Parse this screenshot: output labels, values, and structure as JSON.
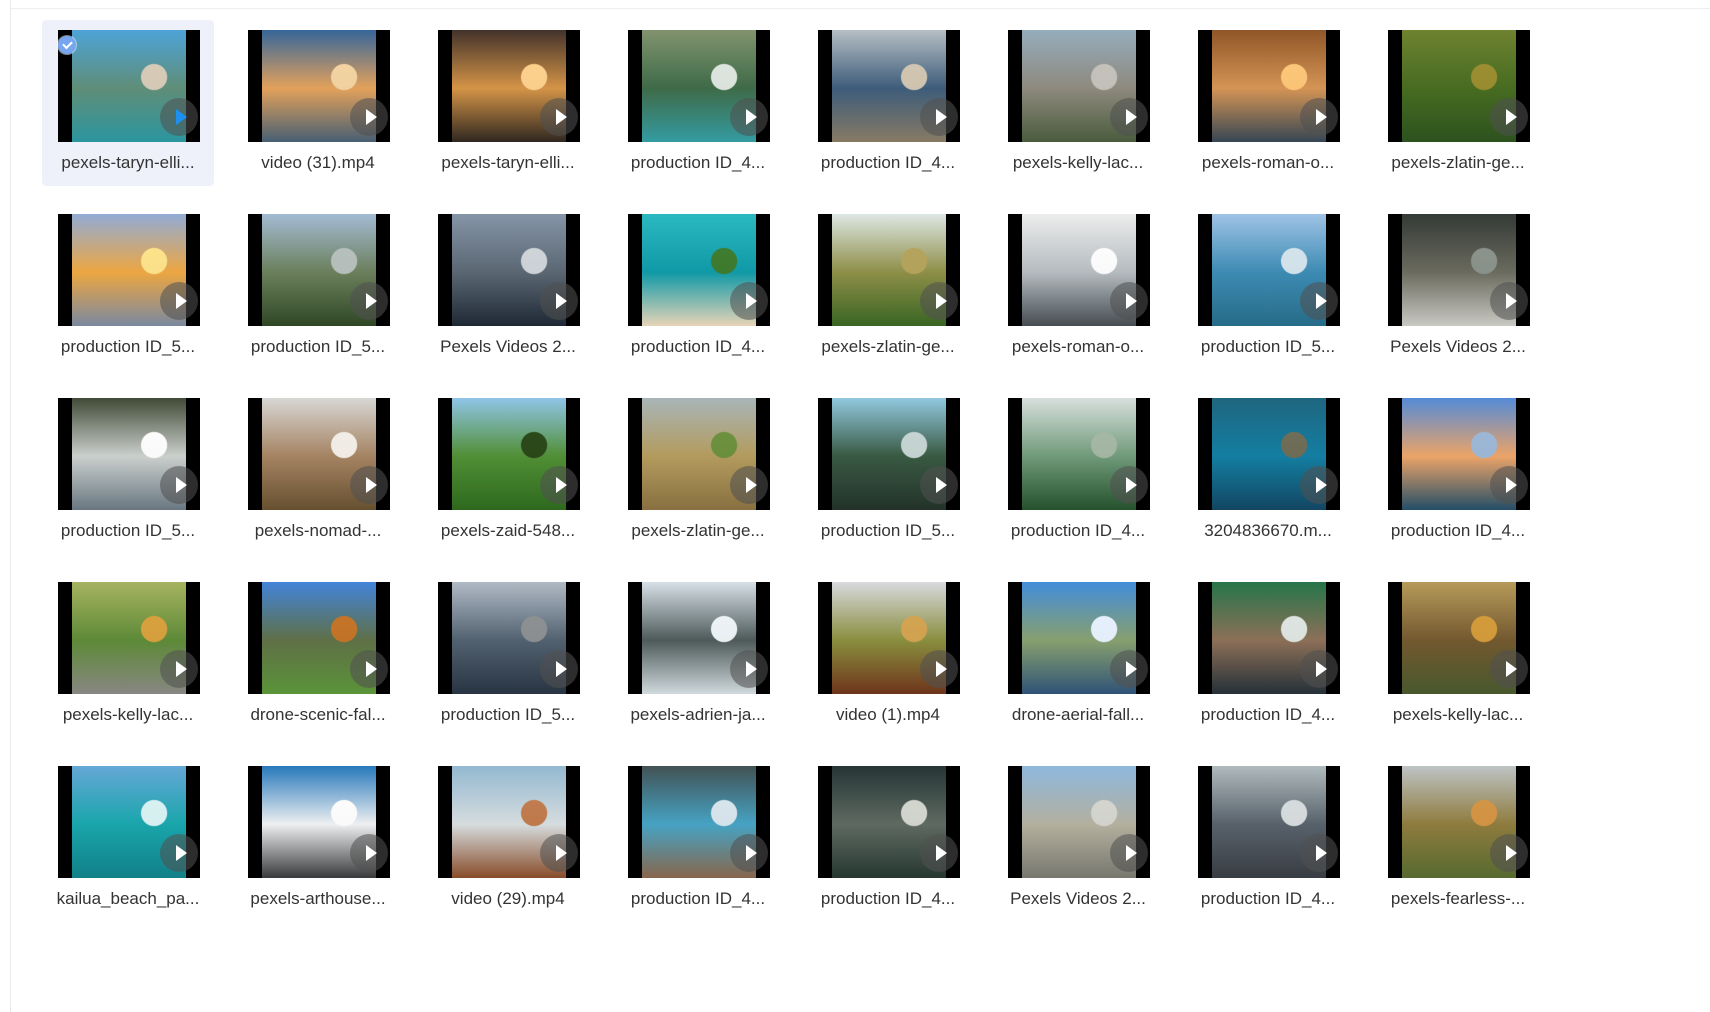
{
  "files": [
    {
      "name": "pexels-taryn-elli...",
      "selected": true,
      "play_color": "#1c8ff0",
      "preview": {
        "top": "#46a0d6",
        "mid": "#5e8e78",
        "bottom": "#2d9ca6",
        "accent": "#d8ccb8"
      }
    },
    {
      "name": "video (31).mp4",
      "selected": false,
      "play_color": "#ffffff",
      "preview": {
        "top": "#2d5f95",
        "mid": "#e7a35a",
        "bottom": "#4a6277",
        "accent": "#f4d4a0"
      }
    },
    {
      "name": "pexels-taryn-elli...",
      "selected": false,
      "play_color": "#ffffff",
      "preview": {
        "top": "#3b2a22",
        "mid": "#d89545",
        "bottom": "#312921",
        "accent": "#ffd28b"
      }
    },
    {
      "name": "production ID_4...",
      "selected": false,
      "play_color": "#ffffff",
      "preview": {
        "top": "#7c8f68",
        "mid": "#3c6a46",
        "bottom": "#36a2a8",
        "accent": "#dfe6df"
      }
    },
    {
      "name": "production ID_4...",
      "selected": false,
      "play_color": "#ffffff",
      "preview": {
        "top": "#b3bcc2",
        "mid": "#3b5b7a",
        "bottom": "#8d7f68",
        "accent": "#d2c6b2"
      }
    },
    {
      "name": "pexels-kelly-lac...",
      "selected": false,
      "play_color": "#ffffff",
      "preview": {
        "top": "#91a9b9",
        "mid": "#8f8a7e",
        "bottom": "#4c5f3f",
        "accent": "#c5c2bb"
      }
    },
    {
      "name": "pexels-roman-o...",
      "selected": false,
      "play_color": "#ffffff",
      "preview": {
        "top": "#8b4f1f",
        "mid": "#d89553",
        "bottom": "#374958",
        "accent": "#ffc777"
      }
    },
    {
      "name": "pexels-zlatin-ge...",
      "selected": false,
      "play_color": "#ffffff",
      "preview": {
        "top": "#687d28",
        "mid": "#456b1d",
        "bottom": "#2e5520",
        "accent": "#9a8c2d"
      }
    },
    {
      "name": "production ID_5...",
      "selected": false,
      "play_color": "#ffffff",
      "preview": {
        "top": "#8ea8d4",
        "mid": "#f1a83f",
        "bottom": "#7f8ea6",
        "accent": "#ffe489"
      }
    },
    {
      "name": "production ID_5...",
      "selected": false,
      "play_color": "#ffffff",
      "preview": {
        "top": "#9fb9d2",
        "mid": "#6a7f5a",
        "bottom": "#314a27",
        "accent": "#b6c0bc"
      }
    },
    {
      "name": "Pexels Videos 2...",
      "selected": false,
      "play_color": "#ffffff",
      "preview": {
        "top": "#8090a4",
        "mid": "#596672",
        "bottom": "#1f2a37",
        "accent": "#d0d5da"
      }
    },
    {
      "name": "production ID_4...",
      "selected": false,
      "play_color": "#ffffff",
      "preview": {
        "top": "#22b6be",
        "mid": "#0c9aa8",
        "bottom": "#f0ddbf",
        "accent": "#3a7a2a"
      }
    },
    {
      "name": "pexels-zlatin-ge...",
      "selected": false,
      "play_color": "#ffffff",
      "preview": {
        "top": "#dce6e3",
        "mid": "#8e8f45",
        "bottom": "#3b6924",
        "accent": "#b4a359"
      }
    },
    {
      "name": "pexels-roman-o...",
      "selected": false,
      "play_color": "#ffffff",
      "preview": {
        "top": "#ececec",
        "mid": "#b7bec2",
        "bottom": "#495055",
        "accent": "#ffffff"
      }
    },
    {
      "name": "production ID_5...",
      "selected": false,
      "play_color": "#ffffff",
      "preview": {
        "top": "#9bc1e5",
        "mid": "#3a8bb5",
        "bottom": "#28708d",
        "accent": "#d4e5ee"
      }
    },
    {
      "name": "Pexels Videos 2...",
      "selected": false,
      "play_color": "#ffffff",
      "preview": {
        "top": "#2c322e",
        "mid": "#6a6a5d",
        "bottom": "#d1d1cb",
        "accent": "#89928a"
      }
    },
    {
      "name": "production ID_5...",
      "selected": false,
      "play_color": "#ffffff",
      "preview": {
        "top": "#39432e",
        "mid": "#ced3d0",
        "bottom": "#6d7b86",
        "accent": "#ffffff"
      }
    },
    {
      "name": "pexels-nomad-...",
      "selected": false,
      "play_color": "#ffffff",
      "preview": {
        "top": "#d6d5d2",
        "mid": "#a68361",
        "bottom": "#6a5331",
        "accent": "#f4efe8"
      }
    },
    {
      "name": "pexels-zaid-548...",
      "selected": false,
      "play_color": "#ffffff",
      "preview": {
        "top": "#8bc3e7",
        "mid": "#4f8f32",
        "bottom": "#2f6d1f",
        "accent": "#264514"
      }
    },
    {
      "name": "pexels-zlatin-ge...",
      "selected": false,
      "play_color": "#ffffff",
      "preview": {
        "top": "#a5b2b5",
        "mid": "#b59c5c",
        "bottom": "#8d7443",
        "accent": "#6a8f3a"
      }
    },
    {
      "name": "production ID_5...",
      "selected": false,
      "play_color": "#ffffff",
      "preview": {
        "top": "#8dc6de",
        "mid": "#365840",
        "bottom": "#24342b",
        "accent": "#c6d5d3"
      }
    },
    {
      "name": "production ID_4...",
      "selected": false,
      "play_color": "#ffffff",
      "preview": {
        "top": "#d6dedc",
        "mid": "#6f9b79",
        "bottom": "#26542e",
        "accent": "#a4b7a4"
      }
    },
    {
      "name": "3204836670.m...",
      "selected": false,
      "play_color": "#ffffff",
      "preview": {
        "top": "#16607a",
        "mid": "#0f7ea3",
        "bottom": "#134966",
        "accent": "#6d6b54"
      }
    },
    {
      "name": "production ID_4...",
      "selected": false,
      "play_color": "#ffffff",
      "preview": {
        "top": "#4d86d5",
        "mid": "#f0a567",
        "bottom": "#25516b",
        "accent": "#9cb8d7"
      }
    },
    {
      "name": "pexels-kelly-lac...",
      "selected": false,
      "play_color": "#ffffff",
      "preview": {
        "top": "#a3b05a",
        "mid": "#5c8a34",
        "bottom": "#8d8c88",
        "accent": "#d8a03a"
      }
    },
    {
      "name": "drone-scenic-fal...",
      "selected": false,
      "play_color": "#ffffff",
      "preview": {
        "top": "#3b7fd8",
        "mid": "#5e6f44",
        "bottom": "#5e9a3b",
        "accent": "#c57223"
      }
    },
    {
      "name": "production ID_5...",
      "selected": false,
      "play_color": "#ffffff",
      "preview": {
        "top": "#adb7c3",
        "mid": "#50606f",
        "bottom": "#2a3645",
        "accent": "#8b8f91"
      }
    },
    {
      "name": "pexels-adrien-ja...",
      "selected": false,
      "play_color": "#ffffff",
      "preview": {
        "top": "#d6dfe6",
        "mid": "#4c5958",
        "bottom": "#d9e2e6",
        "accent": "#eef4f7"
      }
    },
    {
      "name": "video (1).mp4",
      "selected": false,
      "play_color": "#ffffff",
      "preview": {
        "top": "#d6d8dc",
        "mid": "#8a8f3c",
        "bottom": "#72361c",
        "accent": "#d4a34d"
      }
    },
    {
      "name": "drone-aerial-fall...",
      "selected": false,
      "play_color": "#ffffff",
      "preview": {
        "top": "#3b88d9",
        "mid": "#88a16e",
        "bottom": "#31567c",
        "accent": "#e8f2ff"
      }
    },
    {
      "name": "production ID_4...",
      "selected": false,
      "play_color": "#ffffff",
      "preview": {
        "top": "#1d6f42",
        "mid": "#8d6f56",
        "bottom": "#26323a",
        "accent": "#dfe6e2"
      }
    },
    {
      "name": "pexels-kelly-lac...",
      "selected": false,
      "play_color": "#ffffff",
      "preview": {
        "top": "#b39653",
        "mid": "#72572c",
        "bottom": "#4b5b2f",
        "accent": "#d49a36"
      }
    },
    {
      "name": "kailua_beach_pa...",
      "selected": false,
      "play_color": "#ffffff",
      "preview": {
        "top": "#5fa4d5",
        "mid": "#15a7ad",
        "bottom": "#12858d",
        "accent": "#d9f3f4"
      }
    },
    {
      "name": "pexels-arthouse...",
      "selected": false,
      "play_color": "#ffffff",
      "preview": {
        "top": "#1e73b8",
        "mid": "#f3f4f6",
        "bottom": "#3a3c3e",
        "accent": "#ffffff"
      }
    },
    {
      "name": "video (29).mp4",
      "selected": false,
      "play_color": "#ffffff",
      "preview": {
        "top": "#8fb6cf",
        "mid": "#d9e0e2",
        "bottom": "#8d4f2b",
        "accent": "#c17a4a"
      }
    },
    {
      "name": "production ID_4...",
      "selected": false,
      "play_color": "#ffffff",
      "preview": {
        "top": "#3a4b4d",
        "mid": "#44a4c6",
        "bottom": "#8d6a4f",
        "accent": "#d8e6ee"
      }
    },
    {
      "name": "production ID_4...",
      "selected": false,
      "play_color": "#ffffff",
      "preview": {
        "top": "#1d2d2d",
        "mid": "#5d6960",
        "bottom": "#273932",
        "accent": "#d4d6d0"
      }
    },
    {
      "name": "Pexels Videos 2...",
      "selected": false,
      "play_color": "#ffffff",
      "preview": {
        "top": "#8ab5dc",
        "mid": "#b6b2a0",
        "bottom": "#7c7c73",
        "accent": "#d6d6d0"
      }
    },
    {
      "name": "production ID_4...",
      "selected": false,
      "play_color": "#ffffff",
      "preview": {
        "top": "#adb8bb",
        "mid": "#56606a",
        "bottom": "#3a3f45",
        "accent": "#d7dcde"
      }
    },
    {
      "name": "pexels-fearless-...",
      "selected": false,
      "play_color": "#ffffff",
      "preview": {
        "top": "#bbc1c2",
        "mid": "#8f7b3b",
        "bottom": "#5a6e32",
        "accent": "#d49341"
      }
    }
  ]
}
